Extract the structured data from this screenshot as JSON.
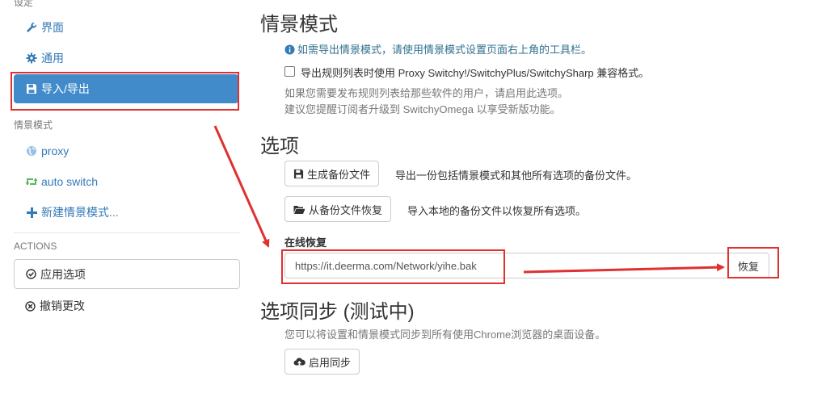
{
  "sidebar": {
    "settings_header": "设定",
    "items": [
      {
        "label": "界面",
        "icon": "wrench-icon"
      },
      {
        "label": "通用",
        "icon": "gear-icon"
      },
      {
        "label": "导入/导出",
        "icon": "floppy-icon"
      }
    ],
    "profiles_header": "情景模式",
    "profiles": [
      {
        "label": "proxy",
        "icon": "globe-icon"
      },
      {
        "label": "auto switch",
        "icon": "retweet-icon"
      },
      {
        "label": "新建情景模式...",
        "icon": "plus-icon"
      }
    ],
    "actions_header": "ACTIONS",
    "apply_label": "应用选项",
    "discard_label": "撤销更改"
  },
  "main": {
    "profiles_title": "情景模式",
    "info_text": "如需导出情景模式，请使用情景模式设置页面右上角的工具栏。",
    "compat_checkbox_label": "导出规则列表时使用 Proxy Switchy!/SwitchyPlus/SwitchySharp 兼容格式。",
    "compat_help_1": "如果您需要发布规则列表给那些软件的用户，请启用此选项。",
    "compat_help_2": "建议您提醒订阅者升级到 SwitchyOmega 以享受新版功能。",
    "options_title": "选项",
    "backup_button": "生成备份文件",
    "backup_desc": "导出一份包括情景模式和其他所有选项的备份文件。",
    "restore_file_button": "从备份文件恢复",
    "restore_file_desc": "导入本地的备份文件以恢复所有选项。",
    "online_restore_label": "在线恢复",
    "online_restore_value": "https://it.deerma.com/Network/yihe.bak",
    "online_restore_button": "恢复",
    "sync_title": "选项同步 (测试中)",
    "sync_desc": "您可以将设置和情景模式同步到所有使用Chrome浏览器的桌面设备。",
    "sync_button": "启用同步"
  },
  "colors": {
    "accent": "#428bca",
    "link": "#337ab7",
    "annotation": "#e03030",
    "auto_switch_icon": "#5cb85c",
    "globe_icon": "#99c0e6"
  }
}
